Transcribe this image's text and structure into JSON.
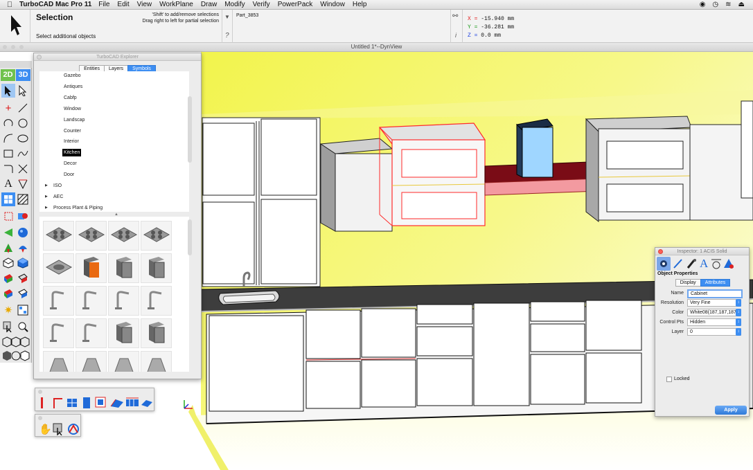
{
  "menubar": {
    "app_name": "TurboCAD Mac Pro 11",
    "items": [
      "File",
      "Edit",
      "View",
      "WorkPlane",
      "Draw",
      "Modify",
      "Verify",
      "PowerPack",
      "Window",
      "Help"
    ]
  },
  "toolbar": {
    "tool_title": "Selection",
    "hint_line1": "'Shift' to add/remove selections",
    "hint_line2": "Drag right to left for partial selection",
    "prompt": "Select additional objects",
    "part_name": "Part_3853",
    "help_symbol": "?",
    "info_symbol": "i",
    "coords": {
      "x_label": "X =",
      "x_value": "-15.940 mm",
      "y_label": "Y =",
      "y_value": "-36.281 mm",
      "z_label": "Z =",
      "z_value": "0.0 mm"
    }
  },
  "window_title": "Untitled 1*--DynView",
  "toolpanel": {
    "label_2d": "2D",
    "label_3d": "3D"
  },
  "explorer": {
    "title": "TurboCAD Explorer",
    "tabs": [
      {
        "label": "Entities",
        "active": false
      },
      {
        "label": "Layers",
        "active": false
      },
      {
        "label": "Symbols",
        "active": true
      }
    ],
    "tree": [
      {
        "label": "Gazebo",
        "level": 2
      },
      {
        "label": "Antiques",
        "level": 2
      },
      {
        "label": "Cabfp",
        "level": 2
      },
      {
        "label": "Window",
        "level": 2
      },
      {
        "label": "Landscap",
        "level": 2
      },
      {
        "label": "Counter",
        "level": 2
      },
      {
        "label": "Interior",
        "level": 2
      },
      {
        "label": "Kitchen",
        "level": 2,
        "selected": true
      },
      {
        "label": "Decor",
        "level": 2
      },
      {
        "label": "Door",
        "level": 2
      },
      {
        "label": "ISO",
        "level": 1
      },
      {
        "label": "AEC",
        "level": 1
      },
      {
        "label": "Process Plant & Piping",
        "level": 1
      }
    ],
    "thumb_icons": [
      "cooktop-icon",
      "cooktop-icon",
      "cooktop-icon",
      "cooktop-icon",
      "sink-icon",
      "oven-icon",
      "cabinet-icon",
      "cabinet-icon",
      "faucet-icon",
      "faucet-icon",
      "faucet-icon",
      "faucet-icon",
      "faucet-icon",
      "faucet-icon",
      "cabinet-icon",
      "cabinet-icon",
      "hood-icon",
      "hood-icon",
      "hood-icon",
      "hood-icon"
    ]
  },
  "inspector": {
    "title": "Inspector: 1 ACIS Solid",
    "section": "Object Properties",
    "tabs": [
      {
        "label": "Display",
        "active": false
      },
      {
        "label": "Attributes",
        "active": true
      }
    ],
    "fields": {
      "name_label": "Name",
      "name_value": "Cabinet",
      "resolution_label": "Resolution",
      "resolution_value": "Very Fine",
      "color_label": "Color",
      "color_value": "White08(187,187,187)",
      "controlpts_label": "Control Pts",
      "controlpts_value": "Hidden",
      "layer_label": "Layer",
      "layer_value": "0"
    },
    "locked_label": "Locked",
    "apply_label": "Apply"
  },
  "colors": {
    "accent": "#3d8ef2",
    "wall_yellow": "#f4f560",
    "selection_red": "#ff2a2a",
    "shelf_dark": "#7a0c16"
  }
}
